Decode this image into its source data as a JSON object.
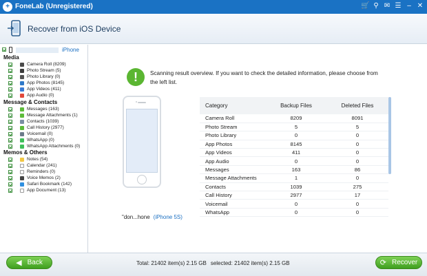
{
  "window": {
    "title": "FoneLab (Unregistered)"
  },
  "header": {
    "title": "Recover from iOS Device"
  },
  "sidebar": {
    "device_name": "iPhone",
    "sections": [
      {
        "title": "Media",
        "items": [
          {
            "label": "Camera Roll (8209)",
            "color": "#4a4a4a"
          },
          {
            "label": "Photo Stream (5)",
            "color": "#3b3b3b"
          },
          {
            "label": "Photo Library (0)",
            "color": "#555555"
          },
          {
            "label": "App Photos (8145)",
            "color": "#2f79c9"
          },
          {
            "label": "App Videos (411)",
            "color": "#3a7bd5"
          },
          {
            "label": "App Audio (0)",
            "color": "#e2483b"
          }
        ]
      },
      {
        "title": "Message & Contacts",
        "items": [
          {
            "label": "Messages (163)",
            "color": "#5dbb3a"
          },
          {
            "label": "Message Attachments (1)",
            "color": "#5dbb3a"
          },
          {
            "label": "Contacts (1039)",
            "color": "#7a8fa3"
          },
          {
            "label": "Call History (2977)",
            "color": "#5dbb3a"
          },
          {
            "label": "Voicemail (0)",
            "color": "#6b7b8a"
          },
          {
            "label": "WhatsApp (0)",
            "color": "#3fbf5a"
          },
          {
            "label": "WhatsApp Attachments (0)",
            "color": "#3fbf5a"
          }
        ]
      },
      {
        "title": "Memos & Others",
        "items": [
          {
            "label": "Notes (54)",
            "color": "#f2c744"
          },
          {
            "label": "Calendar (241)",
            "color": "#ffffff"
          },
          {
            "label": "Reminders (0)",
            "color": "#ffffff"
          },
          {
            "label": "Voice Memos (2)",
            "color": "#444444"
          },
          {
            "label": "Safari Bookmark (142)",
            "color": "#2f8fe0"
          },
          {
            "label": "App Document (13)",
            "color": "#ffffff"
          }
        ]
      }
    ]
  },
  "main": {
    "info_text": "Scanning result overview. If you want to check the detailed information, please choose from the left list.",
    "device_label": "\"don...hone",
    "device_model": "(iPhone 5S)",
    "table": {
      "headers": [
        "Category",
        "Backup Files",
        "Deleted Files"
      ],
      "rows": [
        [
          "Camera Roll",
          "8209",
          "8091"
        ],
        [
          "Photo Stream",
          "5",
          "5"
        ],
        [
          "Photo Library",
          "0",
          "0"
        ],
        [
          "App Photos",
          "8145",
          "0"
        ],
        [
          "App Videos",
          "411",
          "0"
        ],
        [
          "App Audio",
          "0",
          "0"
        ],
        [
          "Messages",
          "163",
          "86"
        ],
        [
          "Message Attachments",
          "1",
          "0"
        ],
        [
          "Contacts",
          "1039",
          "275"
        ],
        [
          "Call History",
          "2977",
          "17"
        ],
        [
          "Voicemail",
          "0",
          "0"
        ],
        [
          "WhatsApp",
          "0",
          "0"
        ]
      ]
    }
  },
  "footer": {
    "back_label": "Back",
    "recover_label": "Recover",
    "total_text": "Total: 21402 item(s) 2.15 GB",
    "selected_text": "selected: 21402 item(s) 2.15 GB"
  },
  "colors": {
    "titlebar": "#1a72c4",
    "accent_green": "#5bb632",
    "link_blue": "#1a6fc2"
  }
}
